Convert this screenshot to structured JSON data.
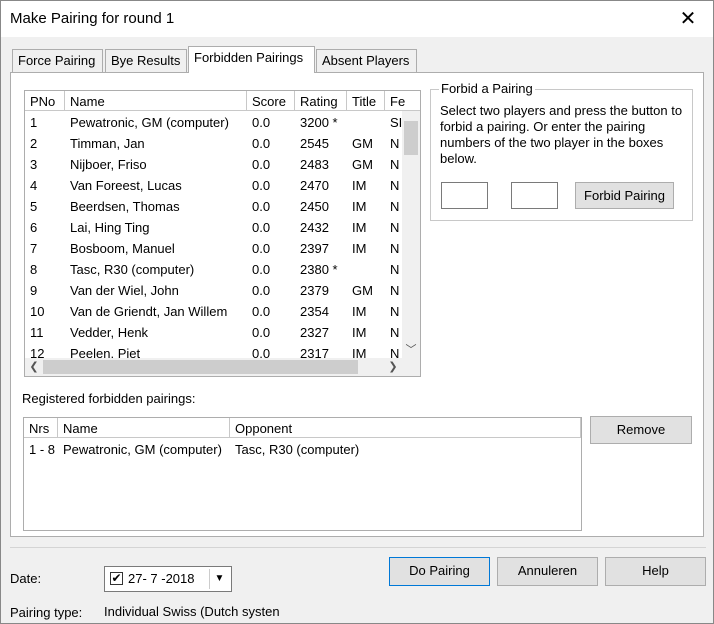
{
  "window": {
    "title": "Make Pairing for round 1",
    "close_glyph": "✕"
  },
  "tabs": [
    {
      "label": "Force Pairing"
    },
    {
      "label": "Bye Results"
    },
    {
      "label": "Forbidden Pairings",
      "active": true
    },
    {
      "label": "Absent Players"
    }
  ],
  "players": {
    "columns": [
      "PNo",
      "Name",
      "Score",
      "Rating",
      "Title",
      "Fe"
    ],
    "rows": [
      [
        "1",
        "Pewatronic, GM (computer)",
        "0.0",
        "3200 *",
        "",
        "SI"
      ],
      [
        "2",
        "Timman, Jan",
        "0.0",
        "2545",
        "GM",
        "N"
      ],
      [
        "3",
        "Nijboer, Friso",
        "0.0",
        "2483",
        "GM",
        "N"
      ],
      [
        "4",
        "Van Foreest, Lucas",
        "0.0",
        "2470",
        "IM",
        "N"
      ],
      [
        "5",
        "Beerdsen, Thomas",
        "0.0",
        "2450",
        "IM",
        "N"
      ],
      [
        "6",
        "Lai, Hing Ting",
        "0.0",
        "2432",
        "IM",
        "N"
      ],
      [
        "7",
        "Bosboom, Manuel",
        "0.0",
        "2397",
        "IM",
        "N"
      ],
      [
        "8",
        "Tasc, R30 (computer)",
        "0.0",
        "2380 *",
        "",
        "N"
      ],
      [
        "9",
        "Van der Wiel, John",
        "0.0",
        "2379",
        "GM",
        "N"
      ],
      [
        "10",
        "Van de Griendt, Jan Willem",
        "0.0",
        "2354",
        "IM",
        "N"
      ],
      [
        "11",
        "Vedder, Henk",
        "0.0",
        "2327",
        "IM",
        "N"
      ],
      [
        "12",
        "Peelen, Piet",
        "0.0",
        "2317",
        "IM",
        "N"
      ]
    ]
  },
  "forbid": {
    "group_title": "Forbid a Pairing",
    "instructions": "Select two players and press the button to forbid a pairing. Or enter the pairing numbers of the two player in the boxes below.",
    "player1_value": "",
    "player2_value": "",
    "button_label": "Forbid Pairing"
  },
  "registered": {
    "label": "Registered forbidden pairings:",
    "columns": [
      "Nrs",
      "Name",
      "Opponent"
    ],
    "rows": [
      [
        "1 - 8",
        "Pewatronic, GM (computer)",
        "Tasc, R30 (computer)"
      ]
    ],
    "remove_label": "Remove"
  },
  "footer": {
    "date_label": "Date:",
    "date_value": "27- 7 -2018",
    "date_checked": true,
    "pairing_type_label": "Pairing type:",
    "pairing_type_value": "Individual Swiss (Dutch systen",
    "do_pairing_label": "Do Pairing",
    "cancel_label": "Annuleren",
    "help_label": "Help"
  }
}
